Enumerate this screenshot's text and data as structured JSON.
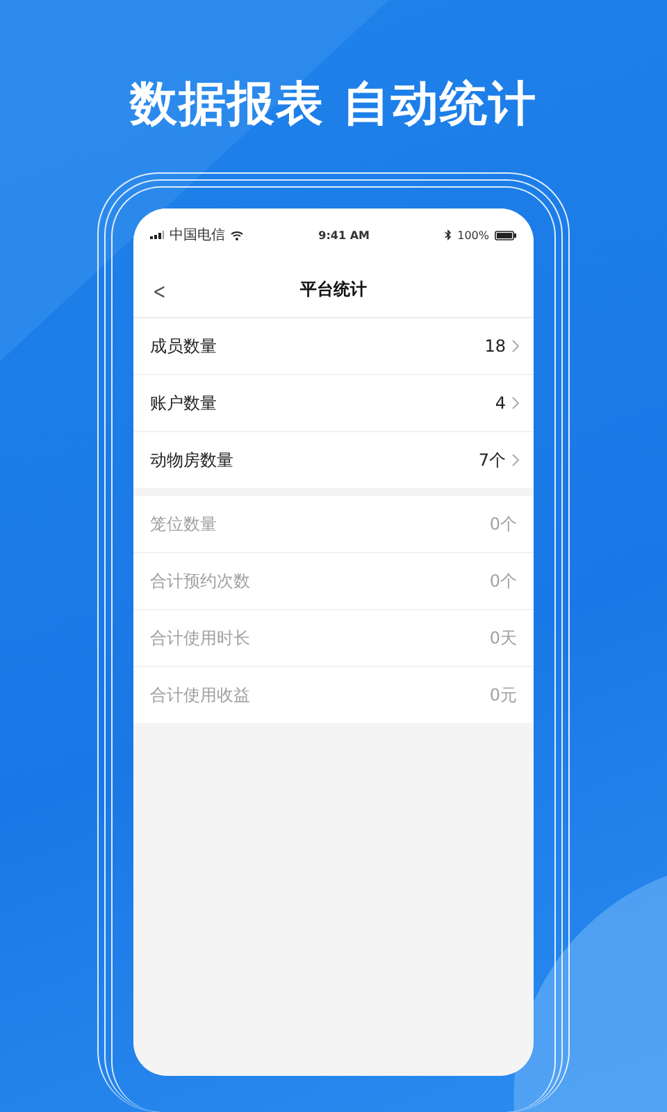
{
  "headline": "数据报表 自动统计",
  "status_bar": {
    "carrier": "中国电信",
    "time": "9:41 AM",
    "battery": "100%"
  },
  "nav": {
    "back": "<",
    "title": "平台统计"
  },
  "groups": [
    {
      "rows": [
        {
          "kind": "link",
          "label": "成员数量",
          "value": "18"
        },
        {
          "kind": "link",
          "label": "账户数量",
          "value": "4"
        },
        {
          "kind": "link",
          "label": "动物房数量",
          "value": "7个"
        }
      ]
    },
    {
      "rows": [
        {
          "kind": "plain",
          "label": "笼位数量",
          "value": "0个"
        },
        {
          "kind": "plain",
          "label": "合计预约次数",
          "value": "0个"
        },
        {
          "kind": "plain",
          "label": "合计使用时长",
          "value": "0天"
        },
        {
          "kind": "plain",
          "label": "合计使用收益",
          "value": "0元"
        }
      ]
    }
  ]
}
